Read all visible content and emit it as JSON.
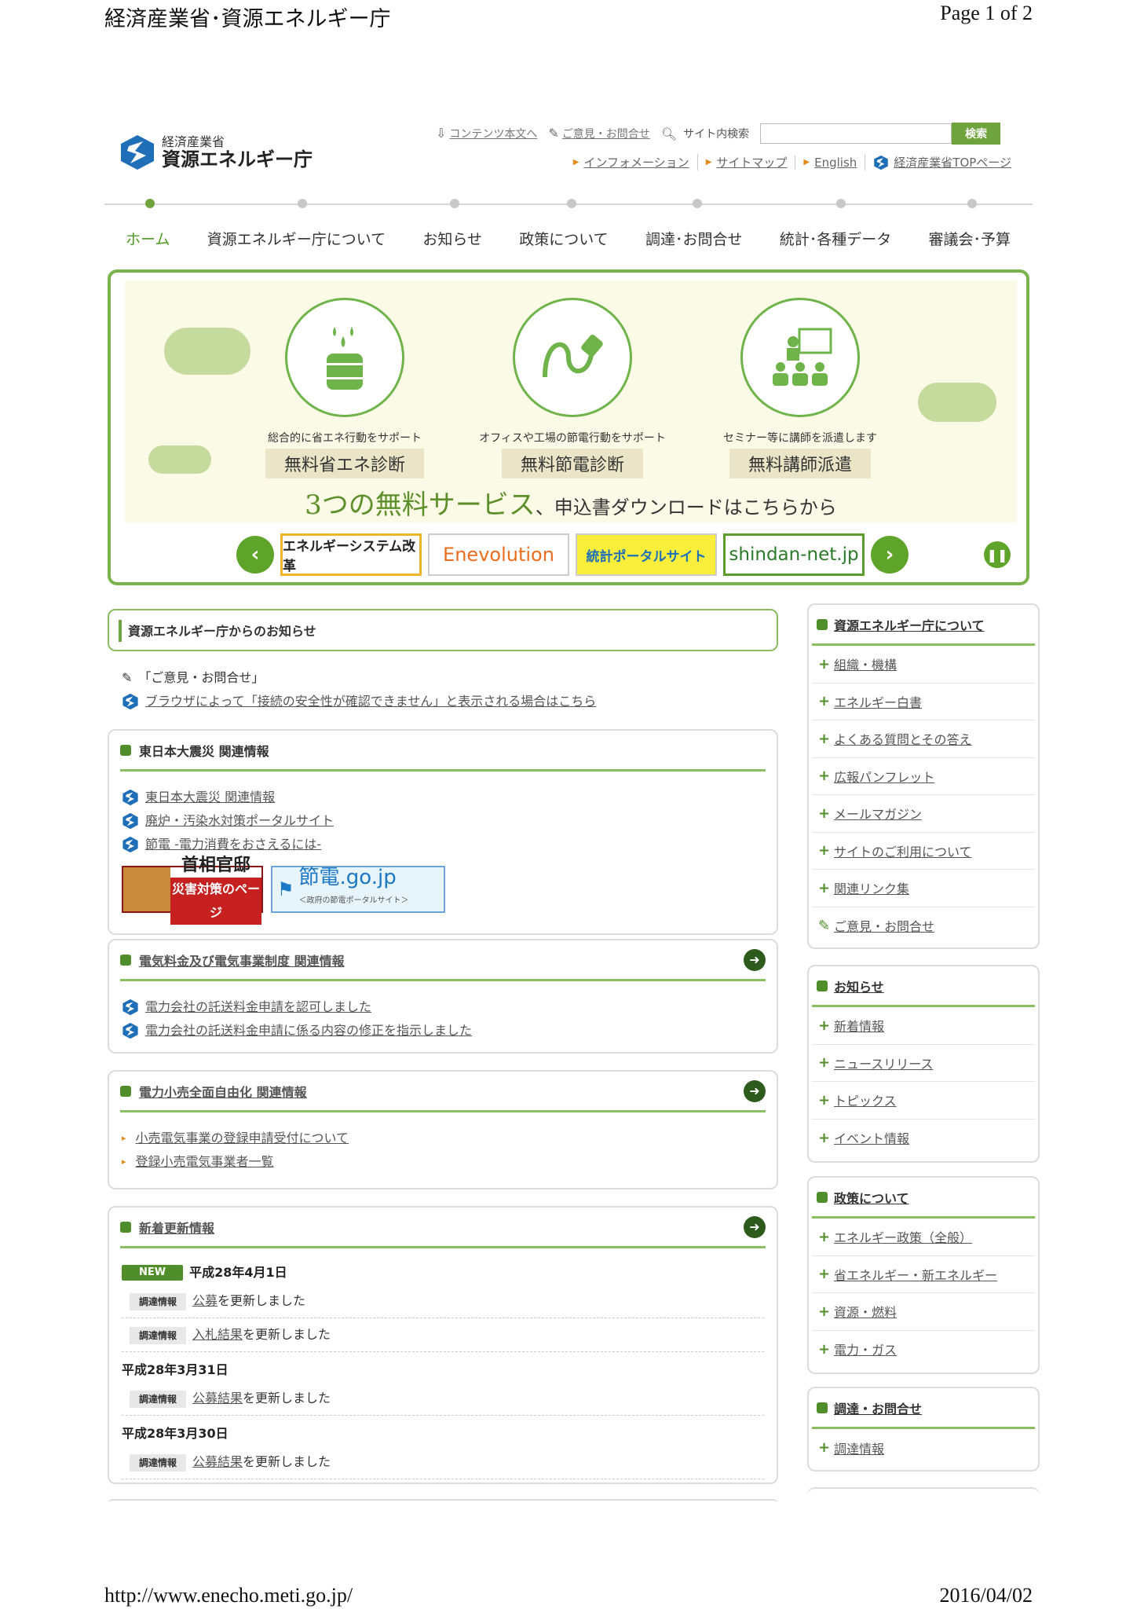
{
  "print_header": {
    "title": "経済産業省･資源エネルギー庁",
    "page": "Page 1 of 2"
  },
  "print_footer": {
    "url": "http://www.enecho.meti.go.jp/",
    "date": "2016/04/02"
  },
  "logo": {
    "sub": "経済産業省",
    "main": "資源エネルギー庁"
  },
  "utility": {
    "skip": "コンテンツ本文へ",
    "feedback": "ご意見・お問合せ",
    "search_label": "サイト内検索",
    "search_value": "",
    "search_button": "検索",
    "links": [
      "インフォメーション",
      "サイトマップ",
      "English",
      "経済産業省TOPページ"
    ]
  },
  "global_nav": [
    "ホーム",
    "資源エネルギー庁について",
    "お知らせ",
    "政策について",
    "調達･お問合せ",
    "統計･各種データ",
    "審議会･予算"
  ],
  "banner": {
    "services": [
      {
        "desc": "総合的に省エネ行動をサポート",
        "name": "無料省エネ診断"
      },
      {
        "desc": "オフィスや工場の節電行動をサポート",
        "name": "無料節電診断"
      },
      {
        "desc": "セミナー等に講師を派遣します",
        "name": "無料講師派遣"
      }
    ],
    "cta_big": "3つの無料サービス",
    "cta_small": "、申込書ダウンロードはこちらから",
    "thumbnails": [
      "エネルギーシステム改革",
      "Enevolution",
      "統計ポータルサイト",
      "shindan-net.jp"
    ]
  },
  "notice": {
    "heading": "資源エネルギー庁からのお知らせ",
    "line1": "「ご意見・お問合せ」",
    "line2": "ブラウザによって「接続の安全性が確認できません」と表示される場合はこちら"
  },
  "box_quake": {
    "title": "東日本大震災 関連情報",
    "links": [
      "東日本大震災 関連情報",
      "廃炉・汚染水対策ポータルサイト",
      "節電 -電力消費をおさえるには-"
    ],
    "banner_kantei_1": "首相官邸",
    "banner_kantei_2": "災害対策のページ",
    "banner_setsuden_1": "節電.go.jp",
    "banner_setsuden_2": "＜政府の節電ポータルサイト＞"
  },
  "box_tariff": {
    "title": "電気料金及び電気事業制度 関連情報",
    "links": [
      "電力会社の託送料金申請を認可しました",
      "電力会社の託送料金申請に係る内容の修正を指示しました"
    ]
  },
  "box_retail": {
    "title": "電力小売全面自由化 関連情報",
    "links": [
      "小売電気事業の登録申請受付について",
      "登録小売電気事業者一覧"
    ]
  },
  "box_updates": {
    "title": "新着更新情報",
    "new_badge": "NEW",
    "groups": [
      {
        "date": "平成28年4月1日",
        "items": [
          {
            "cat": "調達情報",
            "link": "公募",
            "rest": "を更新しました"
          },
          {
            "cat": "調達情報",
            "link": "入札結果",
            "rest": "を更新しました"
          }
        ]
      },
      {
        "date": "平成28年3月31日",
        "items": [
          {
            "cat": "調達情報",
            "link": "公募結果",
            "rest": "を更新しました"
          }
        ]
      },
      {
        "date": "平成28年3月30日",
        "items": [
          {
            "cat": "調達情報",
            "link": "公募結果",
            "rest": "を更新しました"
          }
        ]
      }
    ]
  },
  "sidebar": {
    "about": {
      "title": "資源エネルギー庁について",
      "items": [
        "組織・機構",
        "エネルギー白書",
        "よくある質問とその答え",
        "広報パンフレット",
        "メールマガジン",
        "サイトのご利用について",
        "関連リンク集",
        "ご意見・お問合せ"
      ]
    },
    "news": {
      "title": "お知らせ",
      "items": [
        "新着情報",
        "ニュースリリース",
        "トピックス",
        "イベント情報"
      ]
    },
    "policy": {
      "title": "政策について",
      "items": [
        "エネルギー政策（全般）",
        "省エネルギー・新エネルギー",
        "資源・燃料",
        "電力・ガス"
      ]
    },
    "procurement": {
      "title": "調達・お問合せ",
      "items": [
        "調達情報"
      ]
    }
  },
  "colors": {
    "accent_green": "#6ea33d",
    "dark_green": "#4f8e2a",
    "logo_blue": "#1e6fb8"
  }
}
